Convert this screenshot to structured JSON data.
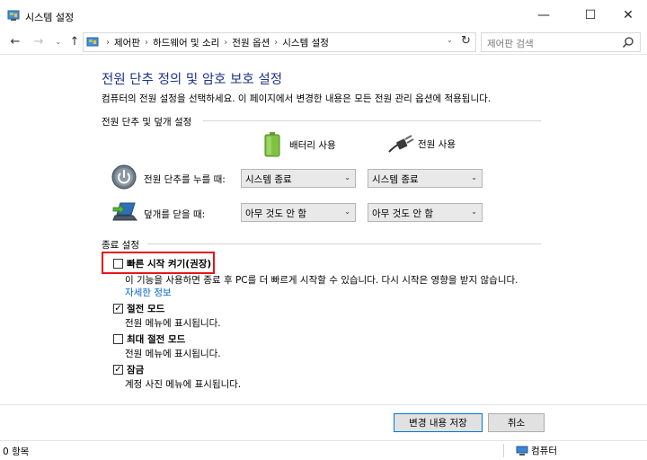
{
  "window": {
    "title": "시스템 설정",
    "minimize_glyph": "—",
    "maximize_glyph": "☐",
    "close_glyph": "✕"
  },
  "nav": {
    "back_glyph": "←",
    "forward_glyph": "→",
    "recent_glyph": "⌄",
    "up_glyph": "↑",
    "refresh_glyph": "↻",
    "breadcrumbs": [
      "제어판",
      "하드웨어 및 소리",
      "전원 옵션",
      "시스템 설정"
    ],
    "breadcrumb_separator": "›",
    "search_placeholder": "제어판 검색"
  },
  "page": {
    "heading": "전원 단추 정의 및 암호 보호 설정",
    "subtitle": "컴퓨터의 전원 설정을 선택하세요. 이 페이지에서 변경한 내용은 모든 전원 관리 옵션에 적용됩니다."
  },
  "power_section": {
    "label": "전원 단추 및 덮개 설정",
    "col_battery": "배터리 사용",
    "col_plugged": "전원 사용",
    "rows": [
      {
        "label": "전원 단추를 누를 때:",
        "battery_value": "시스템 종료",
        "plugged_value": "시스템 종료",
        "icon": "power-button-icon"
      },
      {
        "label": "덮개를 닫을 때:",
        "battery_value": "아무 것도 안 함",
        "plugged_value": "아무 것도 안 함",
        "icon": "laptop-lid-icon"
      }
    ]
  },
  "shutdown_section": {
    "label": "종료 설정",
    "options": [
      {
        "label": "빠른 시작 켜기(권장)",
        "checked": false,
        "description": "이 기능을 사용하면 종료 후 PC를 더 빠르게 시작할 수 있습니다. 다시 시작은 영향을 받지 않습니다.",
        "link": "자세한 정보"
      },
      {
        "label": "절전 모드",
        "checked": true,
        "description": "전원 메뉴에 표시됩니다."
      },
      {
        "label": "최대 절전 모드",
        "checked": false,
        "description": "전원 메뉴에 표시됩니다."
      },
      {
        "label": "잠금",
        "checked": true,
        "description": "계정 사진 메뉴에 표시됩니다."
      }
    ]
  },
  "buttons": {
    "save": "변경 내용 저장",
    "cancel": "취소"
  },
  "statusbar": {
    "items_count": "0 항목",
    "location": "컴퓨터"
  },
  "colors": {
    "heading": "#1e3287",
    "link": "#0066cc",
    "highlight": "#e8141c"
  }
}
